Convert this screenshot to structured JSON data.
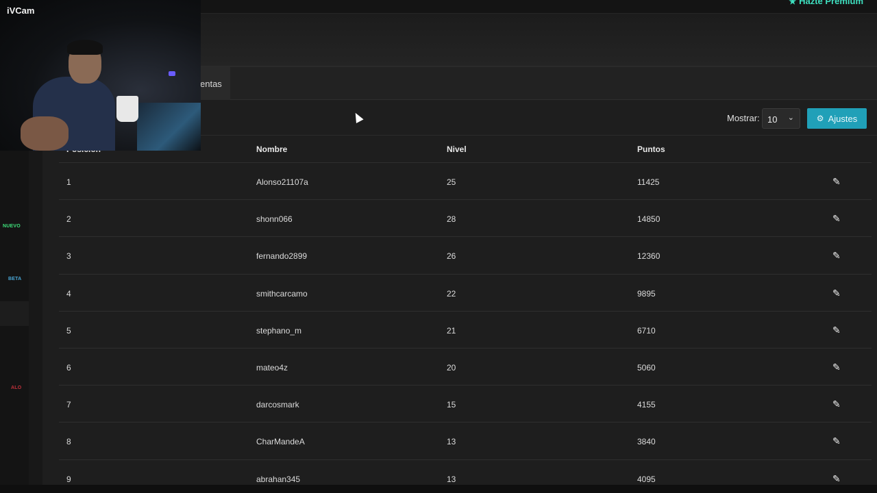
{
  "topbar": {
    "premium_label": "Hazte Premium"
  },
  "tabs": [
    {
      "label": "entas"
    }
  ],
  "sidebar": {
    "badges": [
      "NUEVO",
      "BETA",
      "ALO"
    ]
  },
  "controls": {
    "mostrar_label": "Mostrar:",
    "page_size": "10",
    "ajustes_label": "Ajustes"
  },
  "table": {
    "headers": [
      "Posición",
      "Nombre",
      "Nivel",
      "Puntos"
    ],
    "rows": [
      {
        "pos": "1",
        "name": "Alonso21107a",
        "level": "25",
        "points": "11425"
      },
      {
        "pos": "2",
        "name": "shonn066",
        "level": "28",
        "points": "14850"
      },
      {
        "pos": "3",
        "name": "fernando2899",
        "level": "26",
        "points": "12360"
      },
      {
        "pos": "4",
        "name": "smithcarcamo",
        "level": "22",
        "points": "9895"
      },
      {
        "pos": "5",
        "name": "stephano_m",
        "level": "21",
        "points": "6710"
      },
      {
        "pos": "6",
        "name": "mateo4z",
        "level": "20",
        "points": "5060"
      },
      {
        "pos": "7",
        "name": "darcosmark",
        "level": "15",
        "points": "4155"
      },
      {
        "pos": "8",
        "name": "CharMandeA",
        "level": "13",
        "points": "3840"
      },
      {
        "pos": "9",
        "name": "abrahan345",
        "level": "13",
        "points": "4095"
      }
    ]
  },
  "webcam": {
    "title": "iVCam"
  },
  "colors": {
    "accent": "#20a0b8",
    "premium": "#3ee0c0",
    "nuevo": "#3ee07a",
    "beta": "#4aa8d8"
  }
}
